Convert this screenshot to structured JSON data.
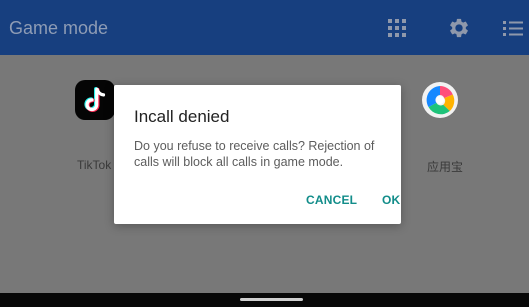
{
  "header": {
    "title": "Game mode",
    "icons": [
      "grid-icon",
      "gear-icon",
      "list-icon"
    ]
  },
  "apps": [
    {
      "label": "TikTok",
      "icon": "tiktok-icon"
    },
    {
      "label": "应用宝",
      "icon": "app-store-icon"
    }
  ],
  "dialog": {
    "title": "Incall denied",
    "message": "Do you refuse to receive calls? Rejection of calls will block all calls in game mode.",
    "cancel_label": "CANCEL",
    "ok_label": "OK"
  },
  "colors": {
    "appbar": "#173f7f",
    "accent": "#128d8a",
    "overlay_bg": "#787878",
    "dialog_bg": "#ffffff"
  }
}
